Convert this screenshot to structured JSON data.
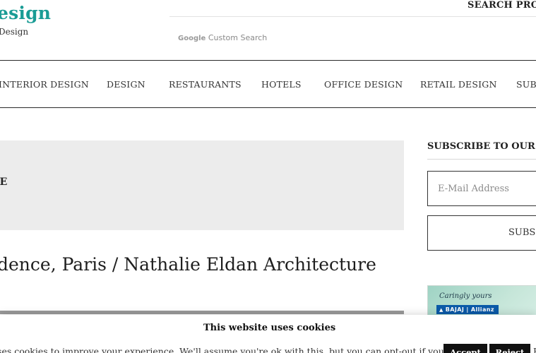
{
  "header": {
    "logo_title": "esign",
    "logo_subtitle": "Design",
    "search_projects_label": "SEARCH PROJE",
    "search": {
      "brand": "Google",
      "placeholder": "Custom Search"
    }
  },
  "nav": {
    "items": [
      "INTERIOR DESIGN",
      "DESIGN",
      "RESTAURANTS",
      "HOTELS",
      "OFFICE DESIGN",
      "RETAIL DESIGN",
      "SUBM"
    ]
  },
  "main": {
    "banner_text": "RE",
    "article_title": "idence, Paris / Nathalie Eldan Architecture"
  },
  "sidebar": {
    "subscribe_heading": "SUBSCRIBE TO OUR NE",
    "email_placeholder": "E-Mail Address",
    "subscribe_button": "SUBSC",
    "ad": {
      "tagline": "Caringly yours",
      "brand": "BAJAJ | Allianz"
    }
  },
  "cookie_banner": {
    "title": "This website uses cookies",
    "text": "uses cookies to improve your experience. We'll assume you're ok with this, but you can opt-out if you wish.",
    "accept_label": "Accept",
    "reject_label": "Reject",
    "trailing_text": "R"
  },
  "colors": {
    "brand_teal": "#1a9c95",
    "button_black": "#111111",
    "banner_gray": "#ececec"
  }
}
